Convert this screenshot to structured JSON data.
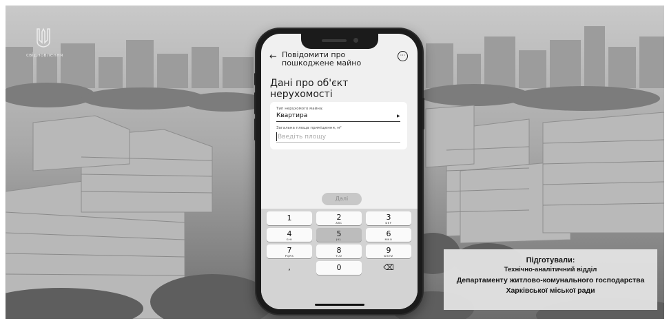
{
  "logo": {
    "text": "свідновлення"
  },
  "app": {
    "header_title_line1": "Повідомити про",
    "header_title_line2": "пошкоджене майно",
    "page_title_line1": "Дані про об'єкт",
    "page_title_line2": "нерухомості",
    "property_type": {
      "label": "Тип нерухомого майна:",
      "value": "Квартира"
    },
    "area": {
      "label": "Загальна площа приміщення, м²",
      "placeholder": "Введіть площу",
      "value": ""
    },
    "submit_label": "Далі",
    "keypad": [
      {
        "digit": "1",
        "letters": ""
      },
      {
        "digit": "2",
        "letters": "ABC"
      },
      {
        "digit": "3",
        "letters": "DEF"
      },
      {
        "digit": "4",
        "letters": "GHI"
      },
      {
        "digit": "5",
        "letters": "JKL"
      },
      {
        "digit": "6",
        "letters": "MNO"
      },
      {
        "digit": "7",
        "letters": "PQRS"
      },
      {
        "digit": "8",
        "letters": "TUV"
      },
      {
        "digit": "9",
        "letters": "WXYZ"
      },
      {
        "digit": ",",
        "letters": ""
      },
      {
        "digit": "0",
        "letters": ""
      },
      {
        "digit": "⌫",
        "letters": ""
      }
    ]
  },
  "credits": {
    "line1": "Підготували:",
    "line2": "Технічно-аналітичний відділ",
    "line3": "Департаменту житлово-комунального господарства",
    "line4": "Харківської міської ради"
  },
  "colors": {
    "screen_bg": "#f0f0f0",
    "keypad_bg": "#d3d3d3",
    "phone_body": "#1b1b1b"
  }
}
